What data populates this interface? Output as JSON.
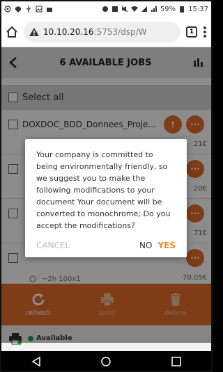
{
  "status_bar": {
    "battery": "59%",
    "time": "15:37"
  },
  "browser": {
    "url_host": "10.10.20.16",
    "url_rest": ":5753/dsp/W",
    "tab_count": "1"
  },
  "app": {
    "title": "6 AVAILABLE JOBS",
    "select_all": "Select all"
  },
  "jobs": [
    {
      "name": "DOXDOC_BDD_Donnees_Proje...",
      "price": "21€"
    },
    {
      "name": "",
      "price": "20€"
    },
    {
      "name": "",
      "price": "71€"
    },
    {
      "name": "",
      "price": "70.05€",
      "meta": "~2h 100x1"
    }
  ],
  "dialog": {
    "message": "Your company is committed to being environmentally friendly, so we suggest you to make the following modifications to your document Your document will be converted to monochrome; Do you accept the modifications?",
    "cancel": "CANCEL",
    "no": "NO",
    "yes": "YES"
  },
  "toolbar": {
    "refresh": "refresh",
    "print": "print",
    "delete": "delete"
  },
  "printer": {
    "name": "",
    "status": "Available"
  },
  "colors": {
    "accent": "#e8702a",
    "yes": "#f08a1c",
    "available": "#1aa64a"
  }
}
